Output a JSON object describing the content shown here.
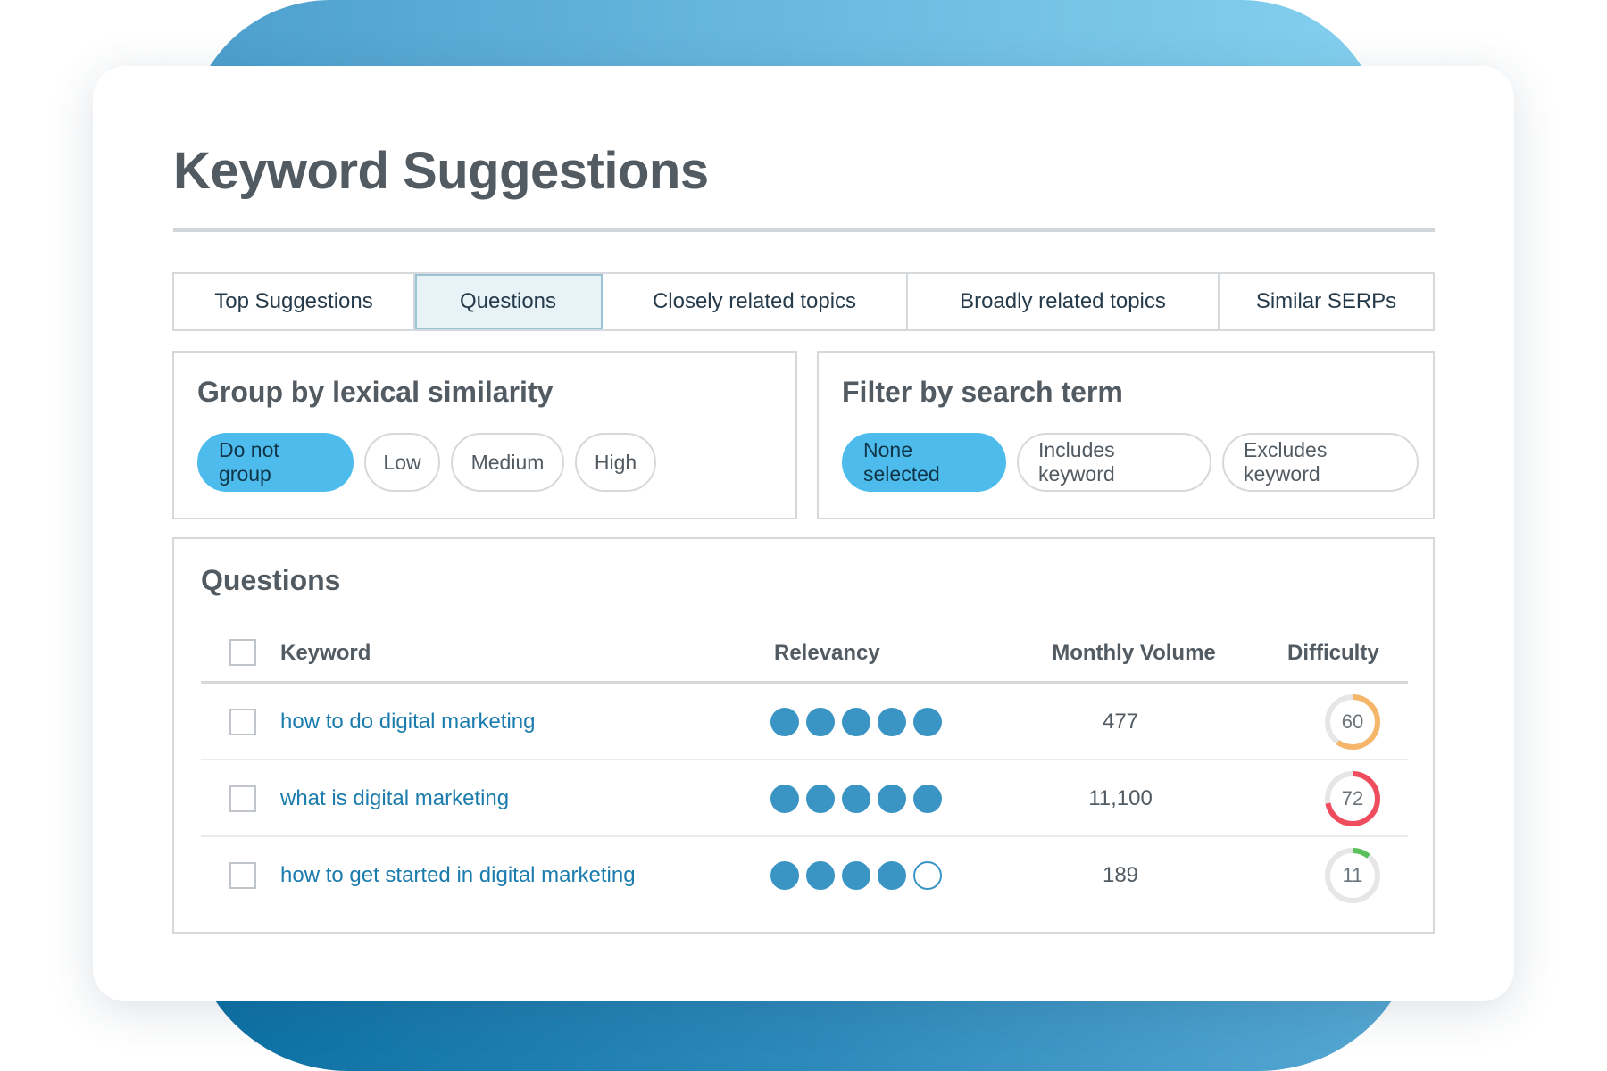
{
  "page": {
    "title": "Keyword Suggestions"
  },
  "tabs": [
    {
      "label": "Top Suggestions",
      "active": false
    },
    {
      "label": "Questions",
      "active": true
    },
    {
      "label": "Closely related topics",
      "active": false
    },
    {
      "label": "Broadly related topics",
      "active": false
    },
    {
      "label": "Similar SERPs",
      "active": false
    }
  ],
  "group_panel": {
    "title": "Group by lexical similarity",
    "options": [
      "Do not group",
      "Low",
      "Medium",
      "High"
    ],
    "selected": "Do not group"
  },
  "filter_panel": {
    "title": "Filter by search term",
    "options": [
      "None selected",
      "Includes keyword",
      "Excludes keyword"
    ],
    "selected": "None selected"
  },
  "table": {
    "title": "Questions",
    "columns": {
      "keyword": "Keyword",
      "relevancy": "Relevancy",
      "volume": "Monthly Volume",
      "difficulty": "Difficulty"
    },
    "rows": [
      {
        "keyword": "how to do digital marketing",
        "relevancy": 5,
        "relevancy_max": 5,
        "volume": "477",
        "difficulty": "60",
        "difficulty_value": 60,
        "difficulty_color": "#f5b66a"
      },
      {
        "keyword": "what is digital marketing",
        "relevancy": 5,
        "relevancy_max": 5,
        "volume": "11,100",
        "difficulty": "72",
        "difficulty_value": 72,
        "difficulty_color": "#ef4d5d"
      },
      {
        "keyword": "how to get started in digital marketing",
        "relevancy": 4,
        "relevancy_max": 5,
        "volume": "189",
        "difficulty": "11",
        "difficulty_value": 11,
        "difficulty_color": "#58c15a"
      }
    ]
  },
  "colors": {
    "accent": "#4dbcec",
    "link": "#1b7cad",
    "dot": "#3a95c5",
    "track": "#e6e6e6"
  }
}
